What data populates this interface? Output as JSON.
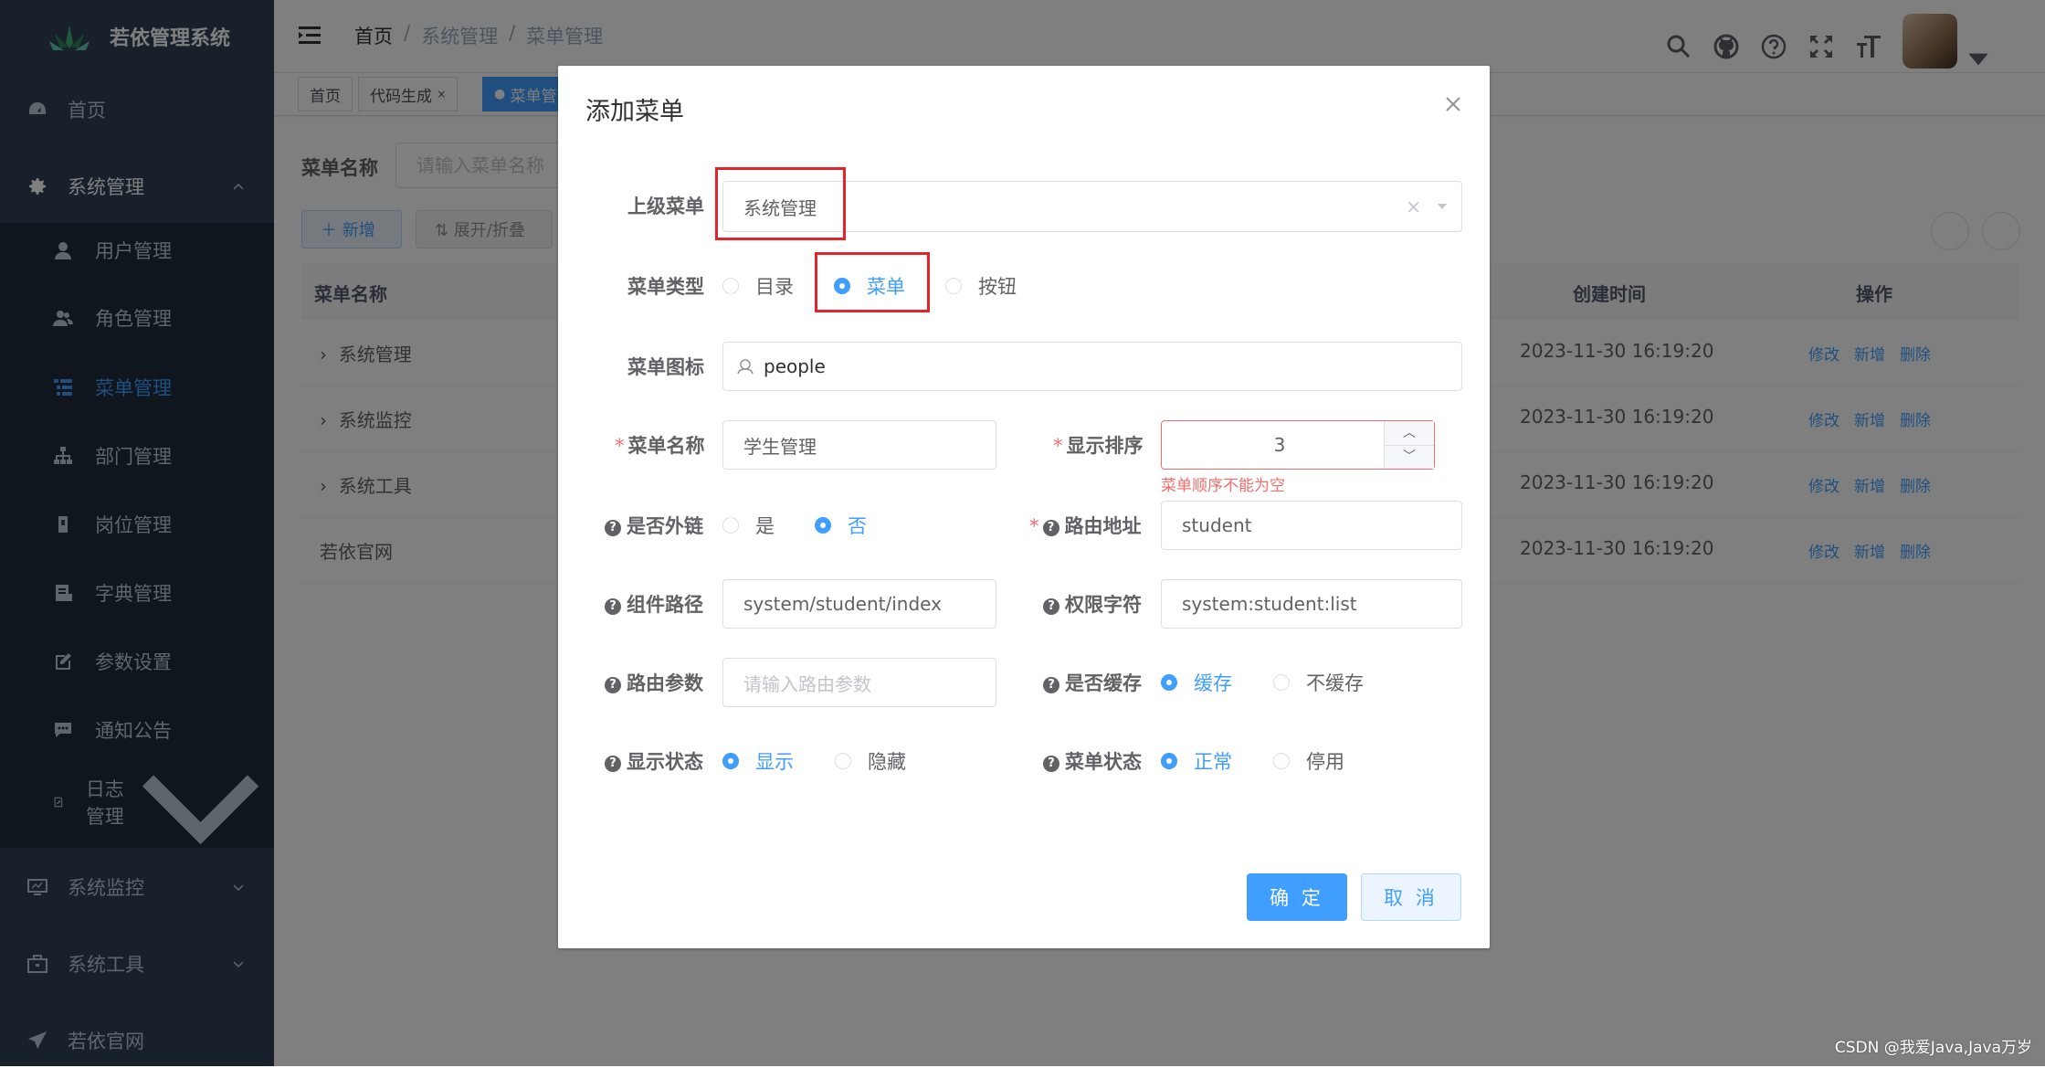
{
  "app": {
    "title": "若依管理系统"
  },
  "sidebar": {
    "home": "首页",
    "system": "系统管理",
    "sub_items": [
      "用户管理",
      "角色管理",
      "菜单管理",
      "部门管理",
      "岗位管理",
      "字典管理",
      "参数设置",
      "通知公告",
      "日志管理"
    ],
    "monitor": "系统监控",
    "tools": "系统工具",
    "website": "若依官网"
  },
  "breadcrumb": [
    "首页",
    "系统管理",
    "菜单管理"
  ],
  "tags": [
    "首页",
    "代码生成",
    "菜单管"
  ],
  "search": {
    "label": "菜单名称",
    "placeholder": "请输入菜单名称"
  },
  "toolbar": {
    "add": "＋ 新增",
    "expand": "⇅ 展开/折叠"
  },
  "table": {
    "headers": {
      "name": "菜单名称",
      "time": "创建时间",
      "ops": "操作"
    },
    "rows": [
      {
        "name": "系统管理",
        "time": "2023-11-30 16:19:20"
      },
      {
        "name": "系统监控",
        "time": "2023-11-30 16:19:20"
      },
      {
        "name": "系统工具",
        "time": "2023-11-30 16:19:20"
      },
      {
        "name": "若依官网",
        "time": "2023-11-30 16:19:20"
      }
    ],
    "ops": {
      "edit": "修改",
      "add": "新增",
      "delete": "删除"
    }
  },
  "dialog": {
    "title": "添加菜单",
    "parent_label": "上级菜单",
    "parent_value": "系统管理",
    "type_label": "菜单类型",
    "type_options": [
      "目录",
      "菜单",
      "按钮"
    ],
    "type_selected": "菜单",
    "icon_label": "菜单图标",
    "icon_value": "people",
    "name_label": "菜单名称",
    "name_value": "学生管理",
    "order_label": "显示排序",
    "order_value": "3",
    "order_error": "菜单顺序不能为空",
    "external_label": "是否外链",
    "external_options": [
      "是",
      "否"
    ],
    "external_selected": "否",
    "route_label": "路由地址",
    "route_value": "student",
    "component_label": "组件路径",
    "component_value": "system/student/index",
    "perm_label": "权限字符",
    "perm_value": "system:student:list",
    "params_label": "路由参数",
    "params_placeholder": "请输入路由参数",
    "cache_label": "是否缓存",
    "cache_options": [
      "缓存",
      "不缓存"
    ],
    "cache_selected": "缓存",
    "visible_label": "显示状态",
    "visible_options": [
      "显示",
      "隐藏"
    ],
    "visible_selected": "显示",
    "status_label": "菜单状态",
    "status_options": [
      "正常",
      "停用"
    ],
    "status_selected": "正常",
    "confirm": "确 定",
    "cancel": "取 消"
  },
  "watermark": "CSDN @我爱Java,Java万岁",
  "colors": {
    "primary": "#409eff",
    "sidebar": "#304156",
    "danger": "#f56c6c",
    "highlight": "#e0262b"
  }
}
